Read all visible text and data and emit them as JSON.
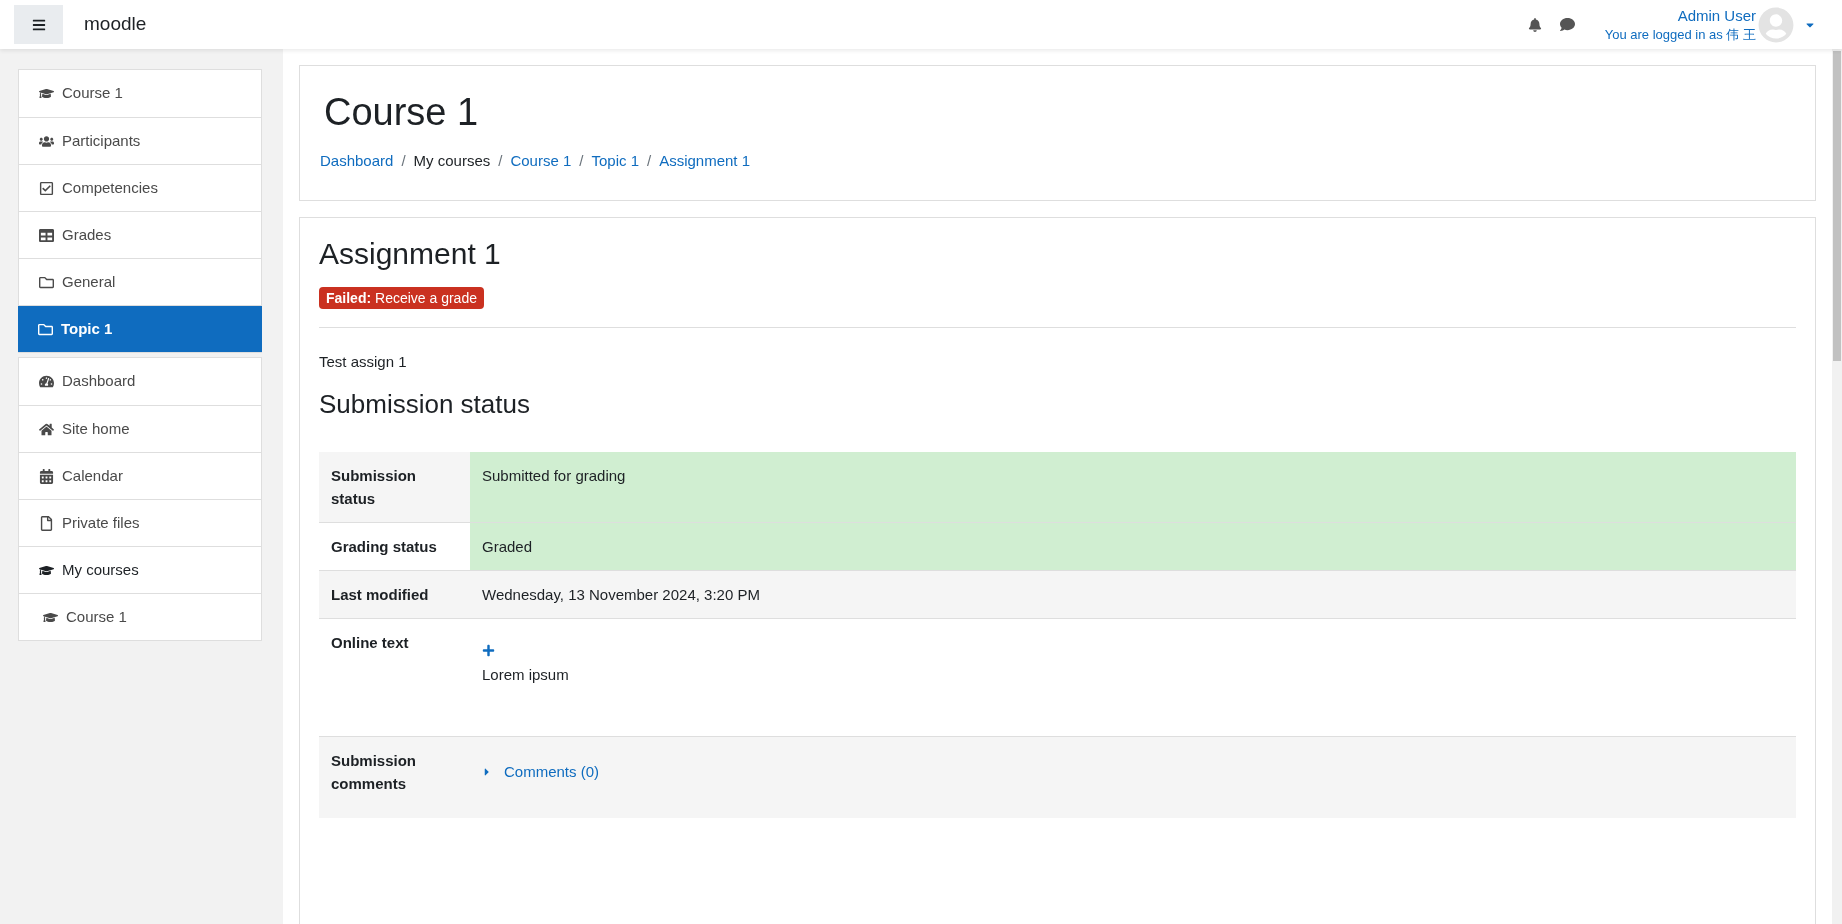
{
  "header": {
    "site_name": "moodle",
    "user_name": "Admin User",
    "login_note": "You are logged in as 伟 王"
  },
  "sidebar": {
    "groups": [
      {
        "items": [
          {
            "kind": "course",
            "label": "Course 1",
            "selected": false
          },
          {
            "kind": "participants",
            "label": "Participants",
            "selected": false
          },
          {
            "kind": "competencies",
            "label": "Competencies",
            "selected": false
          },
          {
            "kind": "grades",
            "label": "Grades",
            "selected": false
          },
          {
            "kind": "section",
            "label": "General",
            "selected": false
          },
          {
            "kind": "section",
            "label": "Topic 1",
            "selected": true
          }
        ]
      },
      {
        "items": [
          {
            "kind": "dashboard",
            "label": "Dashboard",
            "selected": false
          },
          {
            "kind": "home",
            "label": "Site home",
            "selected": false
          },
          {
            "kind": "calendar",
            "label": "Calendar",
            "selected": false
          },
          {
            "kind": "files",
            "label": "Private files",
            "selected": false
          },
          {
            "kind": "courses",
            "label": "My courses",
            "selected": false
          },
          {
            "kind": "subcourse",
            "label": "Course 1",
            "selected": false
          }
        ]
      }
    ]
  },
  "page_header": {
    "title": "Course 1",
    "breadcrumb": [
      {
        "kind": "link",
        "label": "Dashboard"
      },
      {
        "kind": "separator",
        "label": "/"
      },
      {
        "kind": "text",
        "label": "My courses"
      },
      {
        "kind": "separator",
        "label": "/"
      },
      {
        "kind": "link",
        "label": "Course 1"
      },
      {
        "kind": "separator",
        "label": "/"
      },
      {
        "kind": "link",
        "label": "Topic 1"
      },
      {
        "kind": "separator",
        "label": "/"
      },
      {
        "kind": "link",
        "label": "Assignment 1"
      }
    ]
  },
  "assignment": {
    "title": "Assignment 1",
    "completion_badge": "**Failed:** Receive a grade",
    "description": "Test assign 1",
    "section_title": "Submission status",
    "rows": [
      {
        "kind": "text",
        "label": "Submission status",
        "value": "Submitted for grading",
        "highlight": true
      },
      {
        "kind": "text",
        "label": "Grading status",
        "value": "Graded",
        "highlight": true
      },
      {
        "kind": "text",
        "label": "Last modified",
        "value": "Wednesday, 13 November 2024, 3:20 PM",
        "highlight": false
      },
      {
        "kind": "online_text",
        "label": "Online text",
        "value": "Lorem ipsum",
        "highlight": false
      },
      {
        "kind": "comments",
        "label": "Submission comments",
        "value": "Comments (0)",
        "highlight": false
      }
    ]
  }
}
